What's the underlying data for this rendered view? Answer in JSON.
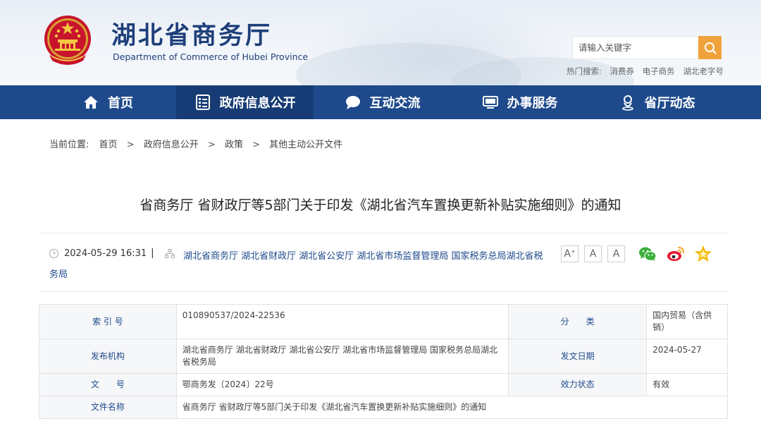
{
  "header": {
    "title": "湖北省商务厅",
    "subtitle": "Department of Commerce of Hubei Province",
    "search": {
      "placeholder": "请输入关键字"
    },
    "hot_label": "热门搜索:",
    "hot_links": [
      "消费券",
      "电子商务",
      "湖北老字号"
    ]
  },
  "nav": {
    "items": [
      {
        "label": "首页",
        "icon": "home-icon"
      },
      {
        "label": "政府信息公开",
        "icon": "document-list-icon"
      },
      {
        "label": "互动交流",
        "icon": "chat-bubble-icon"
      },
      {
        "label": "办事服务",
        "icon": "monitor-icon"
      },
      {
        "label": "省厅动态",
        "icon": "person-pin-icon"
      }
    ],
    "active_index": 1
  },
  "breadcrumb": {
    "label": "当前位置:",
    "items": [
      "首页",
      "政府信息公开",
      "政策",
      "其他主动公开文件"
    ],
    "separator": ">"
  },
  "article": {
    "title": "省商务厅 省财政厅等5部门关于印发《湖北省汽车置换更新补贴实施细则》的通知",
    "date": "2024-05-29 16:31",
    "divider": "|",
    "orgs": "湖北省商务厅 湖北省财政厅 湖北省公安厅 湖北省市场监督管理局 国家税务总局湖北省税务局",
    "font_buttons": [
      "A",
      "A",
      "A"
    ],
    "share_icons": [
      "wechat-icon",
      "weibo-icon",
      "favorite-star-icon"
    ]
  },
  "info": {
    "index_label": "索 引 号",
    "index_value": "010890537/2024-22536",
    "category_label": "分　　类",
    "category_value": "国内贸易（含供销）",
    "publisher_label": "发布机构",
    "publisher_value": "湖北省商务厅 湖北省财政厅 湖北省公安厅 湖北省市场监督管理局 国家税务总局湖北省税务局",
    "issue_date_label": "发文日期",
    "issue_date_value": "2024-05-27",
    "doc_no_label": "文　　号",
    "doc_no_value": "鄂商务发〔2024〕22号",
    "validity_label": "效力状态",
    "validity_value": "有效",
    "filename_label": "文件名称",
    "filename_value": "省商务厅 省财政厅等5部门关于印发《湖北省汽车置换更新补贴实施细则》的通知"
  },
  "colors": {
    "nav_bg": "#1e4a8c",
    "nav_active": "#173c75",
    "search_button": "#f0a23c",
    "title_blue": "#1e3f7a",
    "link_blue": "#1e4a8c"
  }
}
